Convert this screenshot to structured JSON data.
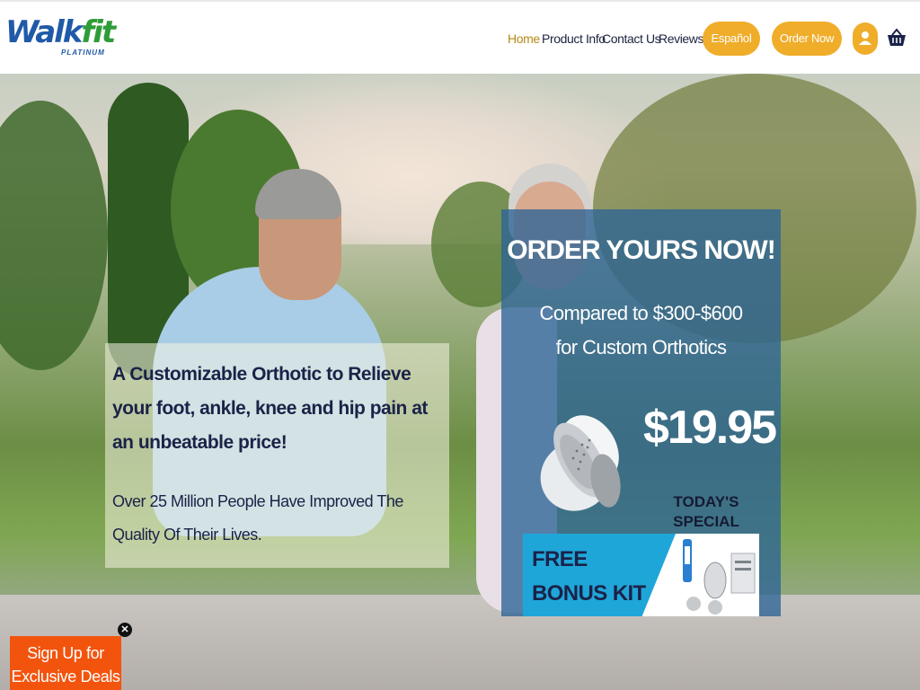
{
  "header": {
    "logo_text_main": "Walk",
    "logo_text_accent": "fit",
    "logo_subtext": "PLATINUM",
    "nav": [
      {
        "label": "Home",
        "active": true
      },
      {
        "label": "Product Info",
        "active": false
      },
      {
        "label": "Contact Us",
        "active": false
      },
      {
        "label": "Reviews",
        "active": false
      }
    ],
    "espanol_label": "Español",
    "order_now_label": "Order Now",
    "account_icon": "user-icon",
    "cart_icon": "basket-icon"
  },
  "hero": {
    "headline": "A Customizable Orthotic to Relieve your foot, ankle, knee and hip pain at an unbeatable price!",
    "subline": "Over 25 Million People Have Improved The Quality Of Their Lives."
  },
  "offer": {
    "title": "ORDER YOURS NOW!",
    "compare_line1": "Compared to $300-$600",
    "compare_line2": "for Custom Orthotics",
    "price": "$19.95",
    "today_line1": "TODAY'S",
    "today_line2": "SPECIAL",
    "bonus_line1": "FREE",
    "bonus_line2": "BONUS KIT"
  },
  "popup": {
    "signup_line1": "Sign Up for",
    "signup_line2": "Exclusive Deals",
    "close_glyph": "✕"
  },
  "colors": {
    "accent": "#f0ad2a",
    "navy": "#1b2248",
    "signup": "#f2540e",
    "offer_panel": "#2d6496"
  }
}
